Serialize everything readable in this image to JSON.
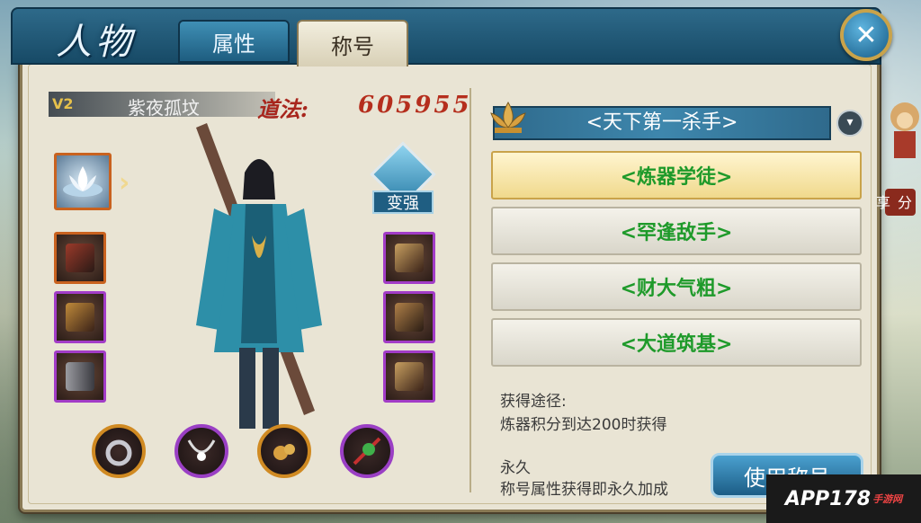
{
  "header": {
    "page_title": "人物",
    "tabs": [
      {
        "label": "属性"
      },
      {
        "label": "称号"
      }
    ],
    "close_icon": "close-icon"
  },
  "character": {
    "vip": "V2",
    "name": "紫夜孤坟",
    "daofa_label": "道法:",
    "daofa_value": "605955",
    "strengthen_label": "变强"
  },
  "equipment": {
    "left": [
      "weapon-slot",
      "helmet-slot",
      "boots-slot"
    ],
    "right": [
      "crest-slot",
      "armor-slot",
      "belt-slot"
    ],
    "bottom": [
      "ring-slot",
      "necklace-slot",
      "amulet-slot",
      "pendant-slot"
    ]
  },
  "titles": {
    "current": "<天下第一杀手>",
    "list": [
      {
        "label": "<炼器学徒>",
        "selected": true
      },
      {
        "label": "<罕逢敌手>",
        "selected": false
      },
      {
        "label": "<财大气粗>",
        "selected": false
      },
      {
        "label": "<大道筑基>",
        "selected": false
      }
    ]
  },
  "detail": {
    "obtain_label": "获得途径:",
    "obtain_value": "炼器积分到达200时获得",
    "duration_label": "永久",
    "duration_value": "称号属性获得即永久加成",
    "use_button": "使用称号"
  },
  "share": {
    "label": "分享"
  },
  "watermark": {
    "text": "APP178",
    "sub": "手游网"
  },
  "colors": {
    "title_green": "#1e9a2a",
    "daofa_red": "#b52e1d",
    "accent_blue": "#2f6a8c"
  }
}
